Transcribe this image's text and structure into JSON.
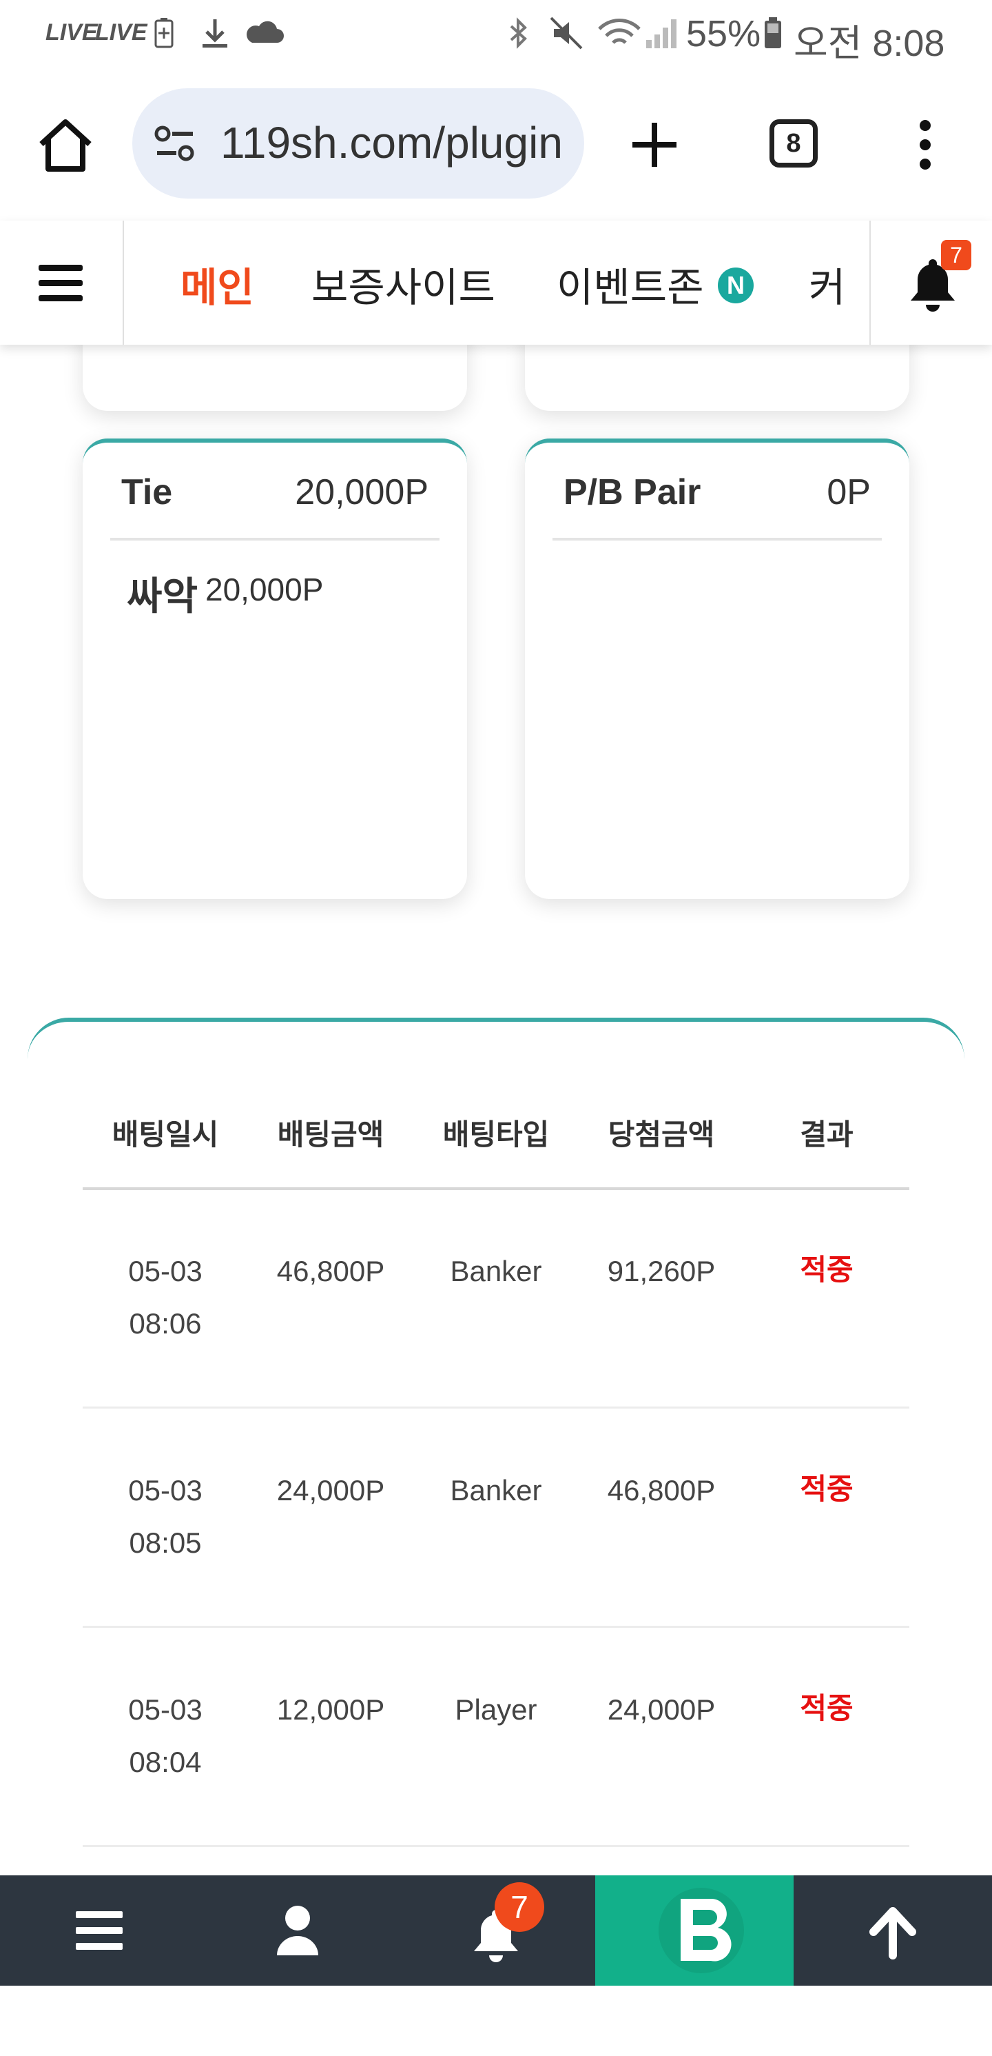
{
  "status_bar": {
    "live_1": "LIVE",
    "live_2": "LIVE",
    "battery_percent": "55%",
    "time": "오전 8:08"
  },
  "browser": {
    "url": "119sh.com/plugin",
    "tab_count": "8"
  },
  "nav": {
    "items": [
      {
        "label": "메인"
      },
      {
        "label": "보증사이트"
      },
      {
        "label": "이벤트존"
      },
      {
        "label": "커"
      }
    ],
    "new_badge": "N",
    "notification_count": "7"
  },
  "cards": [
    {
      "title": "Tie",
      "amount": "20,000P",
      "sub_label": "싸악",
      "sub_value": "20,000P"
    },
    {
      "title": "P/B Pair",
      "amount": "0P"
    }
  ],
  "table": {
    "headers": [
      "배팅일시",
      "배팅금액",
      "배팅타입",
      "당첨금액",
      "결과"
    ],
    "rows": [
      {
        "date": "05-03",
        "time": "08:06",
        "bet": "46,800P",
        "type": "Banker",
        "win": "91,260P",
        "result": "적중"
      },
      {
        "date": "05-03",
        "time": "08:05",
        "bet": "24,000P",
        "type": "Banker",
        "win": "46,800P",
        "result": "적중"
      },
      {
        "date": "05-03",
        "time": "08:04",
        "bet": "12,000P",
        "type": "Player",
        "win": "24,000P",
        "result": "적중"
      }
    ]
  },
  "bottom_bar": {
    "notification_count": "7"
  },
  "colors": {
    "accent_orange": "#f04a1c",
    "teal": "#3aa9a5",
    "result_red": "#e61010",
    "bottom_bar": "#2d3640",
    "bottom_green": "#12b08a"
  }
}
